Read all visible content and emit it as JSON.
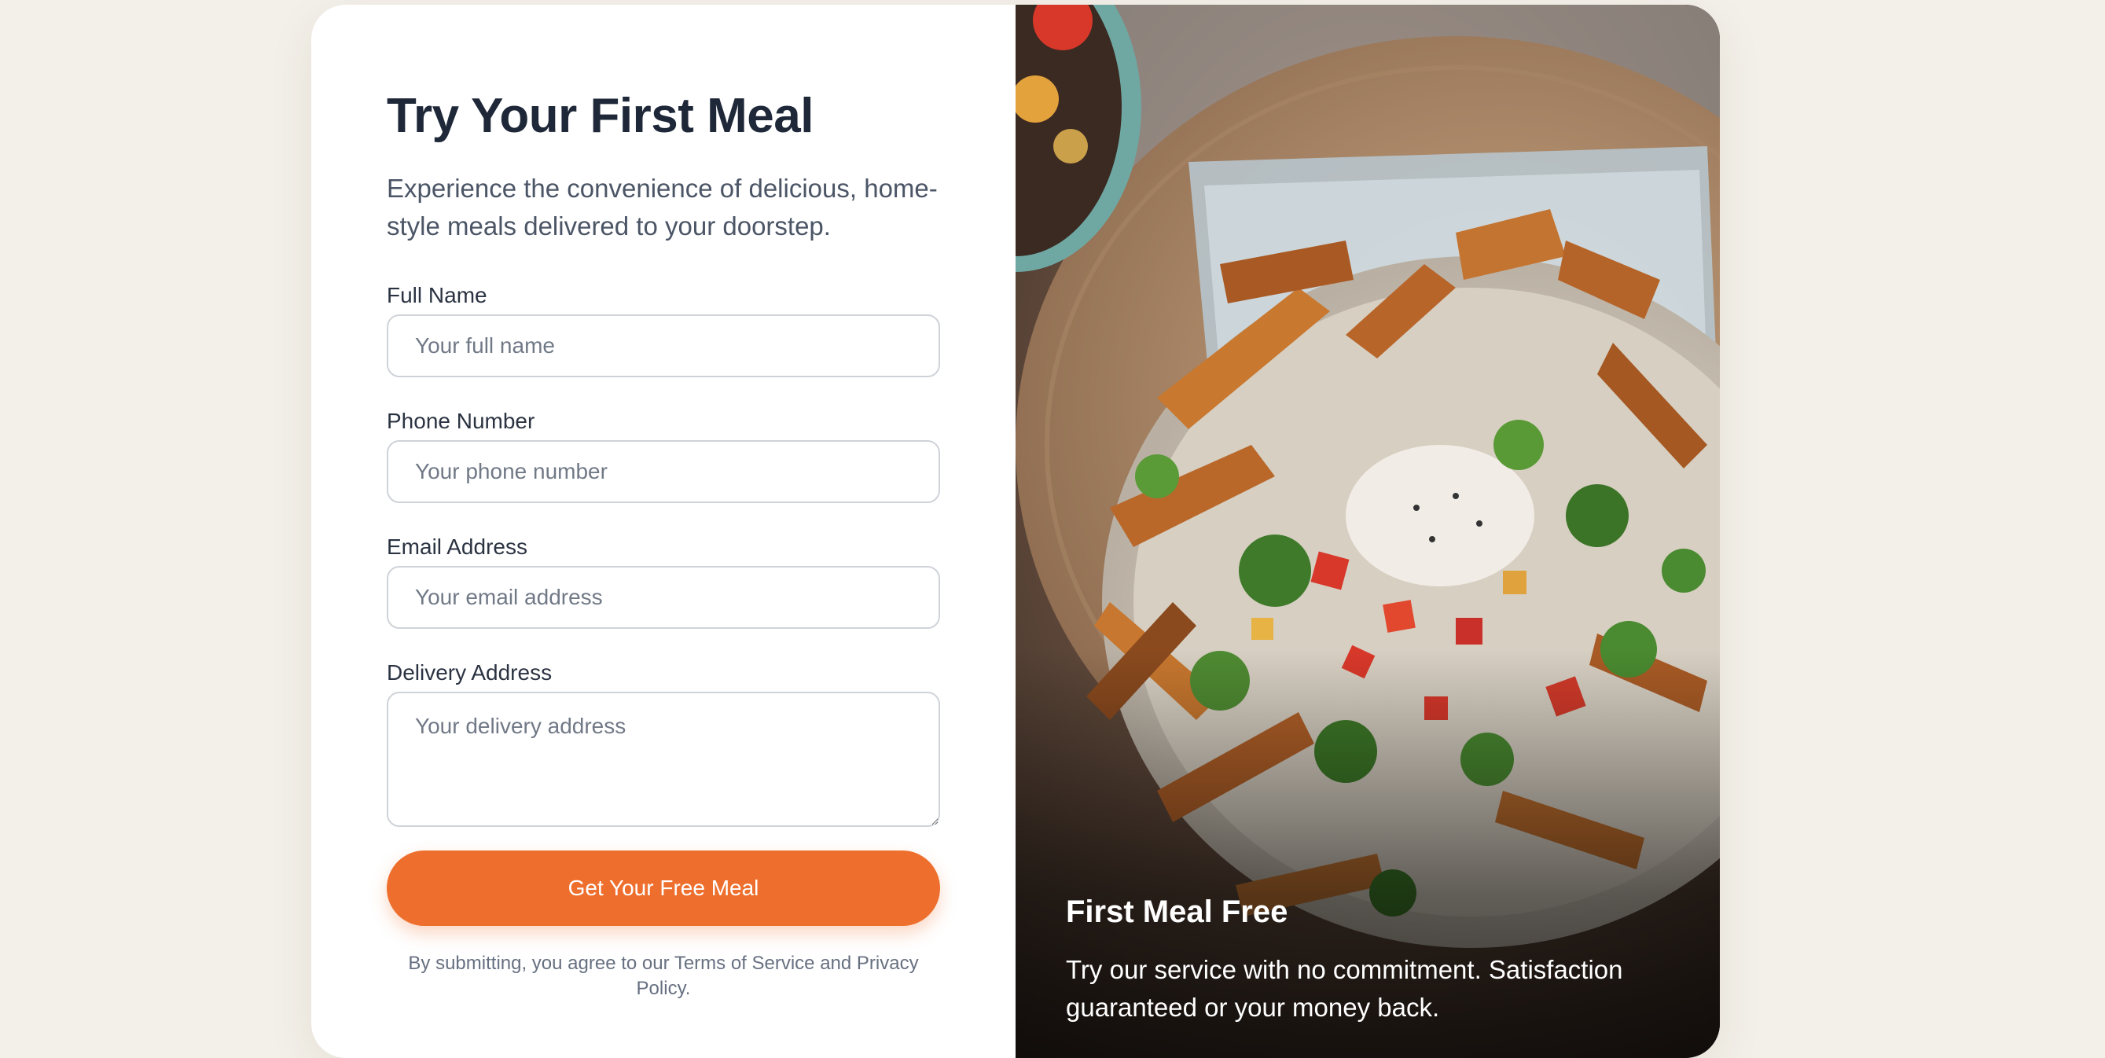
{
  "form": {
    "title": "Try Your First Meal",
    "subtitle": "Experience the convenience of delicious, home-style meals delivered to your doorstep.",
    "fields": [
      {
        "label": "Full Name",
        "placeholder": "Your full name"
      },
      {
        "label": "Phone Number",
        "placeholder": "Your phone number"
      },
      {
        "label": "Email Address",
        "placeholder": "Your email address"
      },
      {
        "label": "Delivery Address",
        "placeholder": "Your delivery address"
      }
    ],
    "submit_label": "Get Your Free Meal",
    "terms": "By submitting, you agree to our Terms of Service and Privacy Policy."
  },
  "promo": {
    "title": "First Meal Free",
    "text": "Try our service with no commitment. Satisfaction guaranteed or your money back."
  },
  "colors": {
    "accent": "#ee6f2d",
    "background": "#f3f0e9",
    "heading": "#1e2838"
  }
}
